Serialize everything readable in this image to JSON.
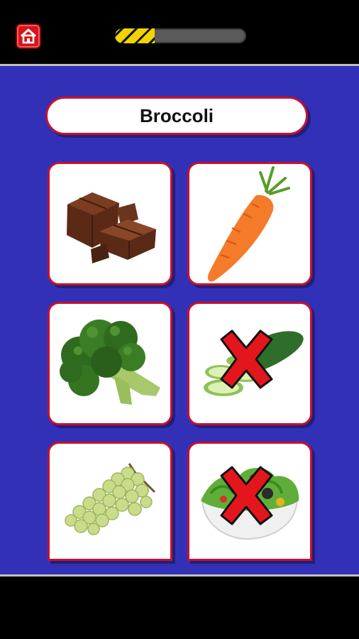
{
  "header": {
    "home_icon": "home-icon",
    "progress": 0.3
  },
  "quiz": {
    "target_word": "Broccoli"
  },
  "cards": [
    {
      "item": "chocolate",
      "icon": "chocolate-image",
      "wrong_mark": false
    },
    {
      "item": "carrot",
      "icon": "carrot-image",
      "wrong_mark": false
    },
    {
      "item": "broccoli",
      "icon": "broccoli-image",
      "wrong_mark": false
    },
    {
      "item": "cucumber",
      "icon": "cucumber-image",
      "wrong_mark": true
    },
    {
      "item": "grapes",
      "icon": "grapes-image",
      "wrong_mark": false
    },
    {
      "item": "salad",
      "icon": "salad-image",
      "wrong_mark": true
    }
  ],
  "colors": {
    "board": "#3330b8",
    "card_border": "#c8102e",
    "home_button": "#d7141a",
    "progress_fill": "#f2d200",
    "wrong_mark": "#e4161d"
  }
}
